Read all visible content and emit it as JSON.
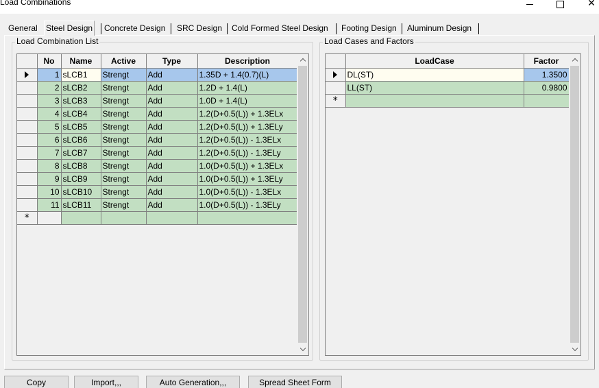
{
  "window": {
    "title": "Load Combinations"
  },
  "tabs": [
    {
      "label": "General"
    },
    {
      "label": "Steel Design"
    },
    {
      "label": "Concrete Design"
    },
    {
      "label": "SRC Design"
    },
    {
      "label": "Cold Formed Steel Design"
    },
    {
      "label": "Footing Design"
    },
    {
      "label": "Aluminum Design"
    }
  ],
  "active_tab": "Steel Design",
  "combination_list": {
    "title": "Load Combination List",
    "columns": [
      "No",
      "Name",
      "Active",
      "Type",
      "Description"
    ],
    "rows": [
      {
        "no": "1",
        "name": "sLCB1",
        "active": "Strengt",
        "type": "Add",
        "description": "1.35D + 1.4(0.7)(L)"
      },
      {
        "no": "2",
        "name": "sLCB2",
        "active": "Strengt",
        "type": "Add",
        "description": "1.2D + 1.4(L)"
      },
      {
        "no": "3",
        "name": "sLCB3",
        "active": "Strengt",
        "type": "Add",
        "description": "1.0D + 1.4(L)"
      },
      {
        "no": "4",
        "name": "sLCB4",
        "active": "Strengt",
        "type": "Add",
        "description": "1.2(D+0.5(L)) + 1.3ELx"
      },
      {
        "no": "5",
        "name": "sLCB5",
        "active": "Strengt",
        "type": "Add",
        "description": "1.2(D+0.5(L)) + 1.3ELy"
      },
      {
        "no": "6",
        "name": "sLCB6",
        "active": "Strengt",
        "type": "Add",
        "description": "1.2(D+0.5(L)) - 1.3ELx"
      },
      {
        "no": "7",
        "name": "sLCB7",
        "active": "Strengt",
        "type": "Add",
        "description": "1.2(D+0.5(L)) - 1.3ELy"
      },
      {
        "no": "8",
        "name": "sLCB8",
        "active": "Strengt",
        "type": "Add",
        "description": "1.0(D+0.5(L)) + 1.3ELx"
      },
      {
        "no": "9",
        "name": "sLCB9",
        "active": "Strengt",
        "type": "Add",
        "description": "1.0(D+0.5(L)) + 1.3ELy"
      },
      {
        "no": "10",
        "name": "sLCB10",
        "active": "Strengt",
        "type": "Add",
        "description": "1.0(D+0.5(L)) - 1.3ELx"
      },
      {
        "no": "11",
        "name": "sLCB11",
        "active": "Strengt",
        "type": "Add",
        "description": "1.0(D+0.5(L)) - 1.3ELy"
      }
    ]
  },
  "load_cases": {
    "title": "Load Cases and Factors",
    "columns": [
      "LoadCase",
      "Factor"
    ],
    "rows": [
      {
        "loadcase": "DL(ST)",
        "factor": "1.3500"
      },
      {
        "loadcase": "LL(ST)",
        "factor": "0.9800"
      }
    ]
  },
  "grid_symbols": {
    "new_row": "*"
  },
  "icons": {
    "current_row": "triangle-right-icon",
    "new_row": "asterisk-icon",
    "scroll_up": "chevron-up-icon",
    "scroll_down": "chevron-down-icon",
    "close": "close-icon"
  },
  "window_controls": {
    "close_glyph": "✕"
  },
  "buttons": {
    "copy": "Copy",
    "import": "Import,,,",
    "auto_generation": "Auto Generation,,,",
    "spread_sheet_form": "Spread Sheet Form"
  },
  "colors": {
    "cell_green": "#c2dfc2",
    "selected_blue": "#a7c7ec",
    "current_cell": "#fffdf0"
  }
}
